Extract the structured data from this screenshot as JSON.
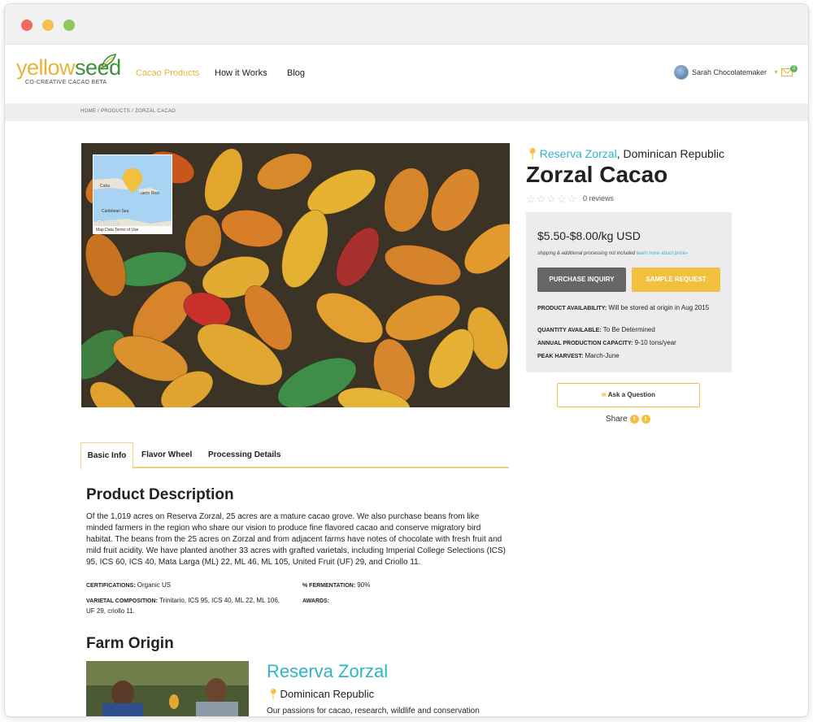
{
  "brand": {
    "name_part1": "yellow",
    "name_part2": "seed",
    "tagline": "CO-CREATIVE CACAO BETA"
  },
  "nav": {
    "items": [
      "Cacao Products",
      "How it Works",
      "Blog"
    ]
  },
  "user": {
    "name": "Sarah Chocolatemaker",
    "mail_count": "2"
  },
  "breadcrumb": "HOME / PRODUCTS / ZORZAL CACAO",
  "map": {
    "label_cuba": "Cuba",
    "label_pr": "uerto Rico",
    "label_sea": "Caribbean Sea",
    "google": "Google",
    "footer": "Map Data  Terms of Use"
  },
  "product": {
    "farm_name": "Reserva Zorzal",
    "country": ", Dominican Republic",
    "title": "Zorzal Cacao",
    "reviews": "0 reviews",
    "price": "$5.50-$8.00/kg USD",
    "shipping_note": "shipping & additional processing not included",
    "shipping_link": "learn more about price»",
    "btn_purchase": "PURCHASE INQUIRY",
    "btn_sample": "SAMPLE REQUEST",
    "specs": [
      {
        "label": "PRODUCT AVAILABILITY:",
        "value": " Will be stored at origin in Aug 2015"
      },
      {
        "label": "QUANTITY AVAILABLE:",
        "value": " To Be Determined"
      },
      {
        "label": "ANNUAL PRODUCTION CAPACITY:",
        "value": " 9-10 tons/year"
      },
      {
        "label": "PEAK HARVEST:",
        "value": " March-June"
      }
    ],
    "ask": "Ask a Question",
    "share": "Share"
  },
  "tabs": [
    "Basic Info",
    "Flavor Wheel",
    "Processing Details"
  ],
  "description": {
    "heading": "Product Description",
    "text": "Of the 1,019 acres on Reserva Zorzal, 25 acres are a mature cacao grove. We also purchase beans from like minded farmers in the region who share our vision to produce fine flavored cacao and conserve migratory bird habitat. The beans from the 25 acres on Zorzal and from adjacent farms have notes of chocolate with fresh fruit and mild fruit acidity. We have planted another 33 acres with grafted varietals, including Imperial College Selections (ICS) 95, ICS 60, ICS 40, Mata Larga (ML) 22, ML 46, ML 105, United Fruit (UF) 29, and Criollo 11.",
    "certifications_label": "CERTIFICATIONS:",
    "certifications_value": " Organic US",
    "fermentation_label": "% FERMENTATION:",
    "fermentation_value": " 90%",
    "varietal_label": "VARIETAL COMPOSITION:",
    "varietal_value": " Trinitario, ICS 95, ICS 40, ML 22, ML 106, UF 29, criollo 11.",
    "awards_label": "AWARDS:"
  },
  "farm": {
    "heading": "Farm Origin",
    "name": "Reserva Zorzal",
    "country": "Dominican Republic",
    "text": "Our passions for cacao, research, wildlife and conservation"
  },
  "colors": {
    "brand_yellow": "#f2bf3e",
    "link_teal": "#2fb4c6",
    "button_gray": "#666666",
    "panel_gray": "#ececec"
  }
}
